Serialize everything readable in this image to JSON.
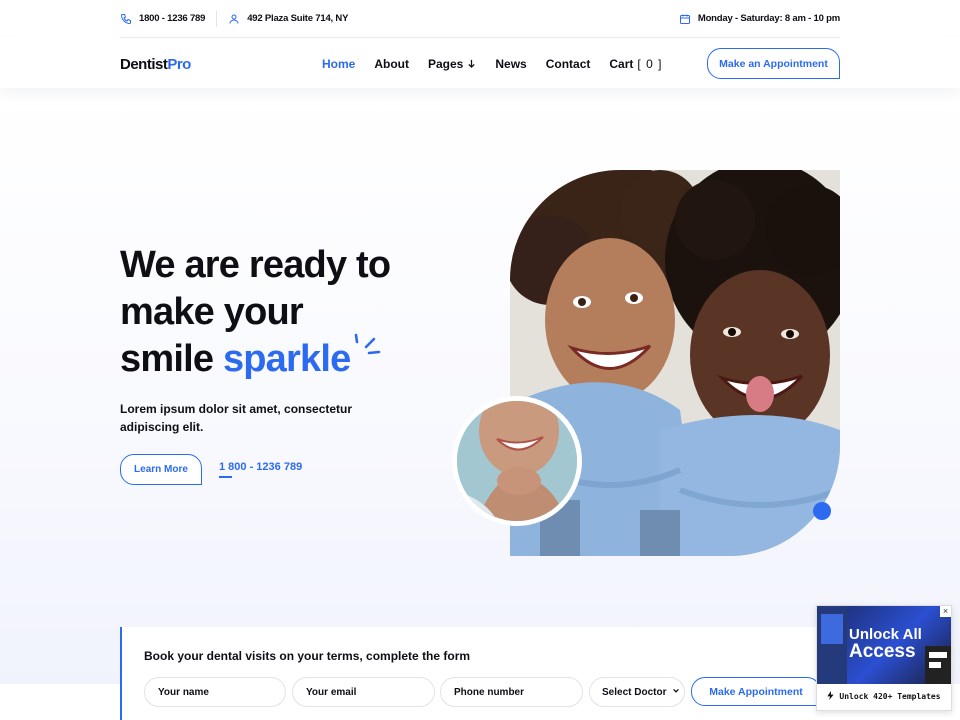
{
  "topbar": {
    "phone": "1800 - 1236 789",
    "address": "492 Plaza Suite 714, NY",
    "hours": "Monday - Saturday: 8 am - 10 pm"
  },
  "header": {
    "logo_main": "Dentist",
    "logo_accent": "Pro",
    "nav": {
      "home": "Home",
      "about": "About",
      "pages": "Pages",
      "news": "News",
      "contact": "Contact",
      "cart": "Cart",
      "cart_count": "[ 0 ]"
    },
    "appointment_button": "Make an Appointment"
  },
  "hero": {
    "title_line1": "We are ready to",
    "title_line2": "make your",
    "title_line3_plain": "smile ",
    "title_line3_accent": "sparkle",
    "description": "Lorem ipsum dolor sit amet, consectetur adipiscing elit.",
    "learn_more": "Learn More",
    "phone": "1 800 - 1236 789"
  },
  "booking": {
    "title": "Book your dental visits on your terms, complete the form",
    "name_placeholder": "Your name",
    "email_placeholder": "Your email",
    "phone_placeholder": "Phone number",
    "doctor_select": "Select Doctor",
    "submit": "Make Appointment"
  },
  "promo": {
    "headline_line1": "Unlock All",
    "headline_line2": "Access",
    "footer": "Unlock 420+ Templates",
    "close": "×"
  },
  "colors": {
    "accent": "#2c6bf0",
    "text": "#0e0e15"
  },
  "icons": {
    "phone": "phone-icon",
    "location": "location-icon",
    "calendar": "calendar-icon",
    "chevron": "chevron-down-icon",
    "bolt": "bolt-icon"
  }
}
